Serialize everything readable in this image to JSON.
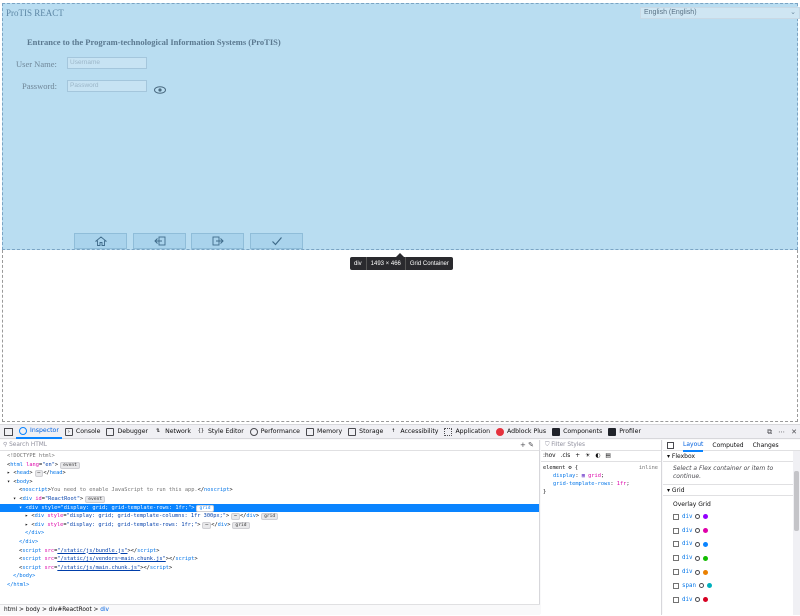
{
  "app": {
    "title": "ProTIS REACT",
    "language": "English (English)",
    "heading": "Entrance to the Program-technological Information Systems (ProTIS)",
    "username_label": "User Name:",
    "username_placeholder": "Username",
    "password_label": "Password:",
    "password_placeholder": "Password",
    "buttons": [
      {
        "icon": "home-icon"
      },
      {
        "icon": "back-icon"
      },
      {
        "icon": "forward-icon"
      },
      {
        "icon": "check-icon"
      }
    ],
    "overlay_color": "#b9ddf1"
  },
  "tooltip": {
    "tag": "div",
    "size": "1493 × 466",
    "label": "Grid Container"
  },
  "devtools": {
    "tabs": [
      {
        "label": "Inspector",
        "icon": "inspector-icon"
      },
      {
        "label": "Console",
        "icon": "console-icon"
      },
      {
        "label": "Debugger",
        "icon": "debugger-icon"
      },
      {
        "label": "Network",
        "icon": "network-icon"
      },
      {
        "label": "Style Editor",
        "icon": "style-editor-icon"
      },
      {
        "label": "Performance",
        "icon": "performance-icon"
      },
      {
        "label": "Memory",
        "icon": "memory-icon"
      },
      {
        "label": "Storage",
        "icon": "storage-icon"
      },
      {
        "label": "Accessibility",
        "icon": "accessibility-icon"
      },
      {
        "label": "Application",
        "icon": "application-icon"
      },
      {
        "label": "Adblock Plus",
        "icon": "adblock-icon"
      },
      {
        "label": "Components",
        "icon": "react-components-icon"
      },
      {
        "label": "Profiler",
        "icon": "react-profiler-icon"
      }
    ],
    "search_placeholder": "Search HTML",
    "tree": {
      "doctype": "<!DOCTYPE html>",
      "html_open_tag": "html",
      "html_attr_name": "lang",
      "html_attr_value": "\"en\"",
      "event_badge": "event",
      "head": "head",
      "body": "body",
      "noscript_tag": "noscript",
      "noscript_text": "You need to enable JavaScript to run this app.",
      "root_tag": "div",
      "root_attr_name": "id",
      "root_attr_value": "\"ReactRoot\"",
      "selected_style": "\"display: grid; grid-template-rows: 1fr;\"",
      "child1_style": "\"display: grid; grid-template-columns: 1fr 300px;\"",
      "child2_style": "\"display: grid; grid-template-rows: 1fr;\"",
      "grid_badge": "grid",
      "script1": "\"/static/js/bundle.js\"",
      "script2": "\"/static/js/vendors~main.chunk.js\"",
      "script3": "\"/static/js/main.chunk.js\"",
      "close_div": "</div>",
      "close_body": "</body>",
      "close_html": "</html>"
    },
    "breadcrumbs": [
      "html",
      "body",
      "div#ReactRoot",
      "div"
    ],
    "rules": {
      "filter_placeholder": "Filter Styles",
      "tools": [
        ":hov",
        ".cls",
        "+"
      ],
      "selector": "element",
      "origin": "inline",
      "decls": [
        {
          "prop": "display",
          "value": "grid"
        },
        {
          "prop": "grid-template-rows",
          "value": "1fr"
        }
      ]
    },
    "layout": {
      "tabs": [
        "Layout",
        "Computed",
        "Changes"
      ],
      "flexbox_heading": "Flexbox",
      "flexbox_note": "Select a Flex container or item to continue.",
      "grid_heading": "Grid",
      "overlay_heading": "Overlay Grid",
      "overlay_items": [
        {
          "name": "div",
          "color": "#9400ff"
        },
        {
          "name": "div",
          "color": "#df00a9"
        },
        {
          "name": "div",
          "color": "#0a84ff"
        },
        {
          "name": "div",
          "color": "#12bc00"
        },
        {
          "name": "div",
          "color": "#ea8000"
        },
        {
          "name": "span",
          "color": "#00b0bd"
        },
        {
          "name": "div",
          "color": "#d70022"
        }
      ]
    }
  }
}
